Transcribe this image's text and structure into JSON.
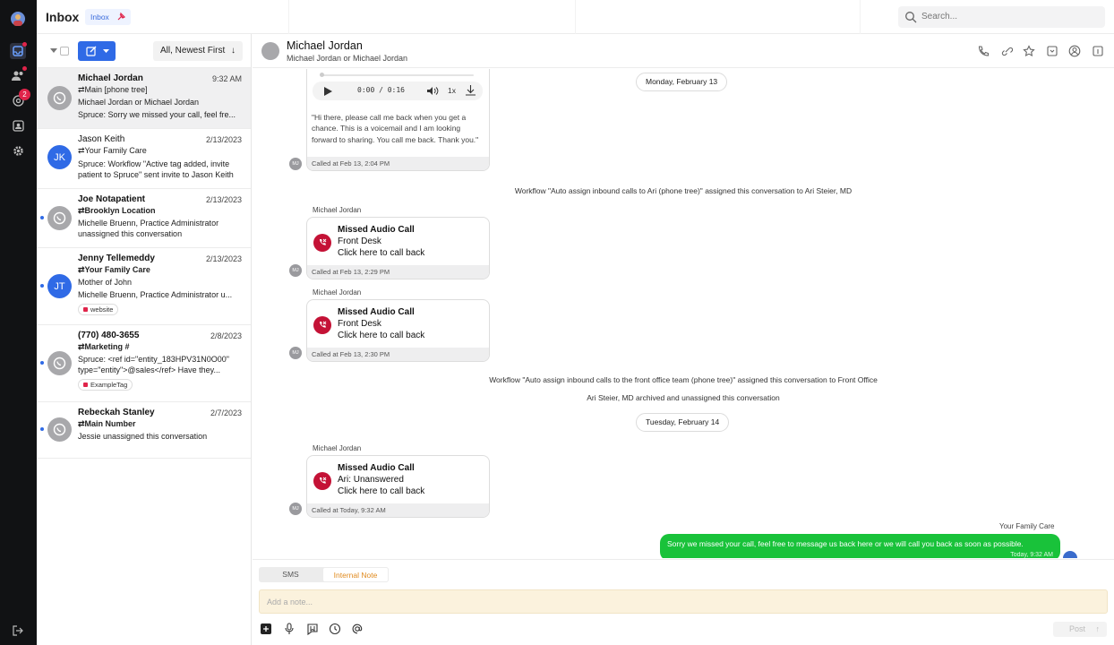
{
  "app": {
    "title": "Inbox",
    "inbox_pill": "Inbox",
    "search_placeholder": "Search...",
    "notification_badge": "2"
  },
  "list": {
    "sort_label": "All, Newest First",
    "conversations": [
      {
        "name": "Michael Jordan",
        "date": "9:32 AM",
        "line1": "⇄Main [phone tree]",
        "line2": "Michael Jordan or Michael Jordan",
        "line3": "Spruce: Sorry we missed your call, feel fre...",
        "initials": ""
      },
      {
        "name": "Jason Keith",
        "date": "2/13/2023",
        "line1": "⇄Your Family Care",
        "line2": "Spruce: Workflow \"Active tag added, invite patient to Spruce\" sent invite to Jason Keith",
        "initials": "JK"
      },
      {
        "name": "Joe Notapatient",
        "date": "2/13/2023",
        "line1": "⇄Brooklyn Location",
        "line2": "Michelle Bruenn, Practice Administrator unassigned this conversation"
      },
      {
        "name": "Jenny Tellemeddy",
        "date": "2/13/2023",
        "line1": "⇄Your Family Care",
        "line2": "Mother of John",
        "line3": "Michelle Bruenn, Practice Administrator u...",
        "tag": "website",
        "initials": "JT"
      },
      {
        "name": "(770) 480-3655",
        "date": "2/8/2023",
        "line1": "⇄Marketing #",
        "line2": "Spruce: <ref id=\"entity_183HPV31N0O00\" type=\"entity\">@sales</ref> Have they...",
        "tag": "ExampleTag"
      },
      {
        "name": "Rebeckah Stanley",
        "date": "2/7/2023",
        "line1": "⇄Main Number",
        "line2": "Jessie unassigned this conversation"
      }
    ]
  },
  "conversation": {
    "name": "Michael Jordan",
    "subtitle": "Michael Jordan or Michael Jordan",
    "voicemail": {
      "time": "0:00 / 0:16",
      "speed": "1x",
      "transcript": "\"Hi there, please call me back when you get a chance. This is a voicemail and I am looking forward to sharing. You call me back. Thank you.\"",
      "footer": "Called at Feb 13, 2:04 PM"
    },
    "day1": "Monday, February 13",
    "sys1": "Workflow \"Auto assign inbound calls to Ari (phone tree)\" assigned this conversation to Ari Steier, MD",
    "calls": [
      {
        "sender": "Michael Jordan",
        "title": "Missed Audio Call",
        "line": "Front Desk",
        "action": "Click here to call back",
        "footer": "Called at Feb 13, 2:29 PM"
      },
      {
        "sender": "Michael Jordan",
        "title": "Missed Audio Call",
        "line": "Front Desk",
        "action": "Click here to call back",
        "footer": "Called at Feb 13, 2:30 PM"
      },
      {
        "sender": "Michael Jordan",
        "title": "Missed Audio Call",
        "line": "Ari: Unanswered",
        "action": "Click here to call back",
        "footer": "Called at Today, 9:32 AM"
      }
    ],
    "sys2": "Workflow \"Auto assign inbound calls to the front office team (phone tree)\" assigned this conversation to Front Office",
    "sys3": "Ari Steier, MD archived and unassigned this conversation",
    "day2": "Tuesday, February 14",
    "avatar_initials": "MJ",
    "outgoing": {
      "sender": "Your Family Care",
      "text": "Sorry we missed your call, feel free to message us back here or we will call you back as soon as possible.",
      "time": "Today, 9:32 AM"
    }
  },
  "composer": {
    "tab_sms": "SMS",
    "tab_note": "Internal Note",
    "placeholder": "Add a note...",
    "post": "Post"
  }
}
